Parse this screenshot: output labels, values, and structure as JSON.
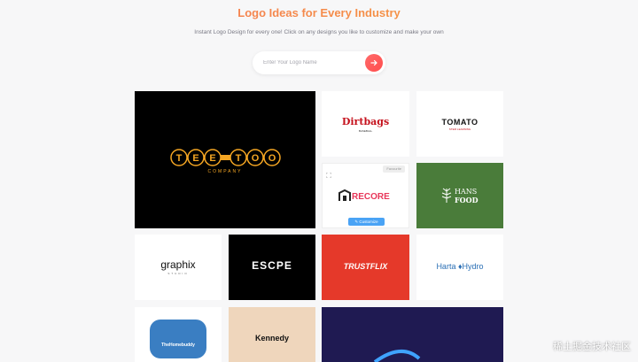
{
  "header": {
    "title": "Logo Ideas for Every Industry",
    "subtitle": "Instant Logo Design for every one! Click on any designs you like to customize and make your own"
  },
  "search": {
    "placeholder": "Enter Your Logo Name"
  },
  "logos": {
    "teetoo_main": "TEE-TOO",
    "teetoo_sub": "COMPANY",
    "dirtbags_main": "Dirtbags",
    "dirtbags_sub": "BASEBALL",
    "tomato_main": "TOMATO",
    "tomato_sub": "STEM LEARNING",
    "arecore": "ARECORE",
    "hans_1": "HANS",
    "hans_2": "FOOD",
    "graphix": "graphix",
    "graphix_sub": "STUDIO",
    "escape": "ESCPE",
    "trustflix": "TRUSTFLIX",
    "hartahydro_1": "Harta",
    "hartahydro_2": "Hydro",
    "homebuddy": "TheHomebuddy",
    "kennedy": "Kennedy"
  },
  "card_actions": {
    "favorite_label": "Favourite",
    "customize_label": "Customize"
  },
  "watermark": "稀土掘金技术社区",
  "colors": {
    "accent": "#f2793a",
    "button": "#ff5a5a",
    "customize": "#4aa3f5"
  }
}
